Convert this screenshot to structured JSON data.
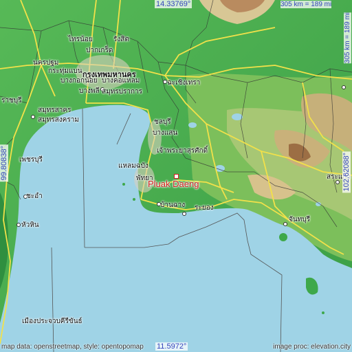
{
  "map": {
    "highlight_place": "Pluak Daeng",
    "coords": {
      "top_lat": "14.33769°",
      "bottom_lat": "11.5972°",
      "left_lon": "99.80838°",
      "right_lon": "102.62088°"
    },
    "scale": {
      "horizontal": "305 km = 189 mi",
      "vertical": "305 km = 189 mi"
    },
    "footer": {
      "left": "map data: openstreetmap, style: opentopomap",
      "right": "image proc: elevation.city"
    },
    "colors": {
      "sea": "#9fd3e6",
      "lowland": "#3ea84a",
      "hills": "#e8d9a6",
      "mountains": "#b8885a",
      "roads": "#f2e14a",
      "highlight": "#d01e1e"
    },
    "places": [
      {
        "id": "nonthaburi",
        "name": "ไทรน้อย"
      },
      {
        "id": "rangsit",
        "name": "รังสิต"
      },
      {
        "id": "pakkret",
        "name": "ปากเกร็ด"
      },
      {
        "id": "nakhonpathom",
        "name": "นครปฐม"
      },
      {
        "id": "krathumbaen",
        "name": "กระทุ่มแบน"
      },
      {
        "id": "bangkok",
        "name": "กรุงเทพมหานคร"
      },
      {
        "id": "bangkoknoi",
        "name": "บางกอกน้อย"
      },
      {
        "id": "bangkholaem",
        "name": "บางคอแหลม"
      },
      {
        "id": "samutprakan",
        "name": "สมุทรปราการ"
      },
      {
        "id": "chachoengsao",
        "name": "ฉะเชิงเทรา"
      },
      {
        "id": "bangphli",
        "name": "บางพลี"
      },
      {
        "id": "ratchaburi",
        "name": "ราชบุรี"
      },
      {
        "id": "samutsakhon",
        "name": "สมุทรสาคร"
      },
      {
        "id": "samutsongkhram",
        "name": "สมุทรสงคราม"
      },
      {
        "id": "chonburi",
        "name": "ชลบุรี"
      },
      {
        "id": "saensuk",
        "name": "บางแสน"
      },
      {
        "id": "sriracha",
        "name": "เจ้าพระยาสุรศักดิ์"
      },
      {
        "id": "petchaburi",
        "name": "เพชรบุรี"
      },
      {
        "id": "laemchabang",
        "name": "แหลมฉบัง"
      },
      {
        "id": "cha-am",
        "name": "ชะอำ"
      },
      {
        "id": "pattaya",
        "name": "พัทยา"
      },
      {
        "id": "banchang",
        "name": "บ้านฉาง"
      },
      {
        "id": "rayong",
        "name": "ระยอง"
      },
      {
        "id": "huahin",
        "name": "หัวหิน"
      },
      {
        "id": "chanthaburi",
        "name": "จันทบุรี"
      },
      {
        "id": "sakaeo",
        "name": "สระแก้ว"
      },
      {
        "id": "prachuap",
        "name": "เมืองประจวบคีรีขันธ์"
      }
    ]
  }
}
